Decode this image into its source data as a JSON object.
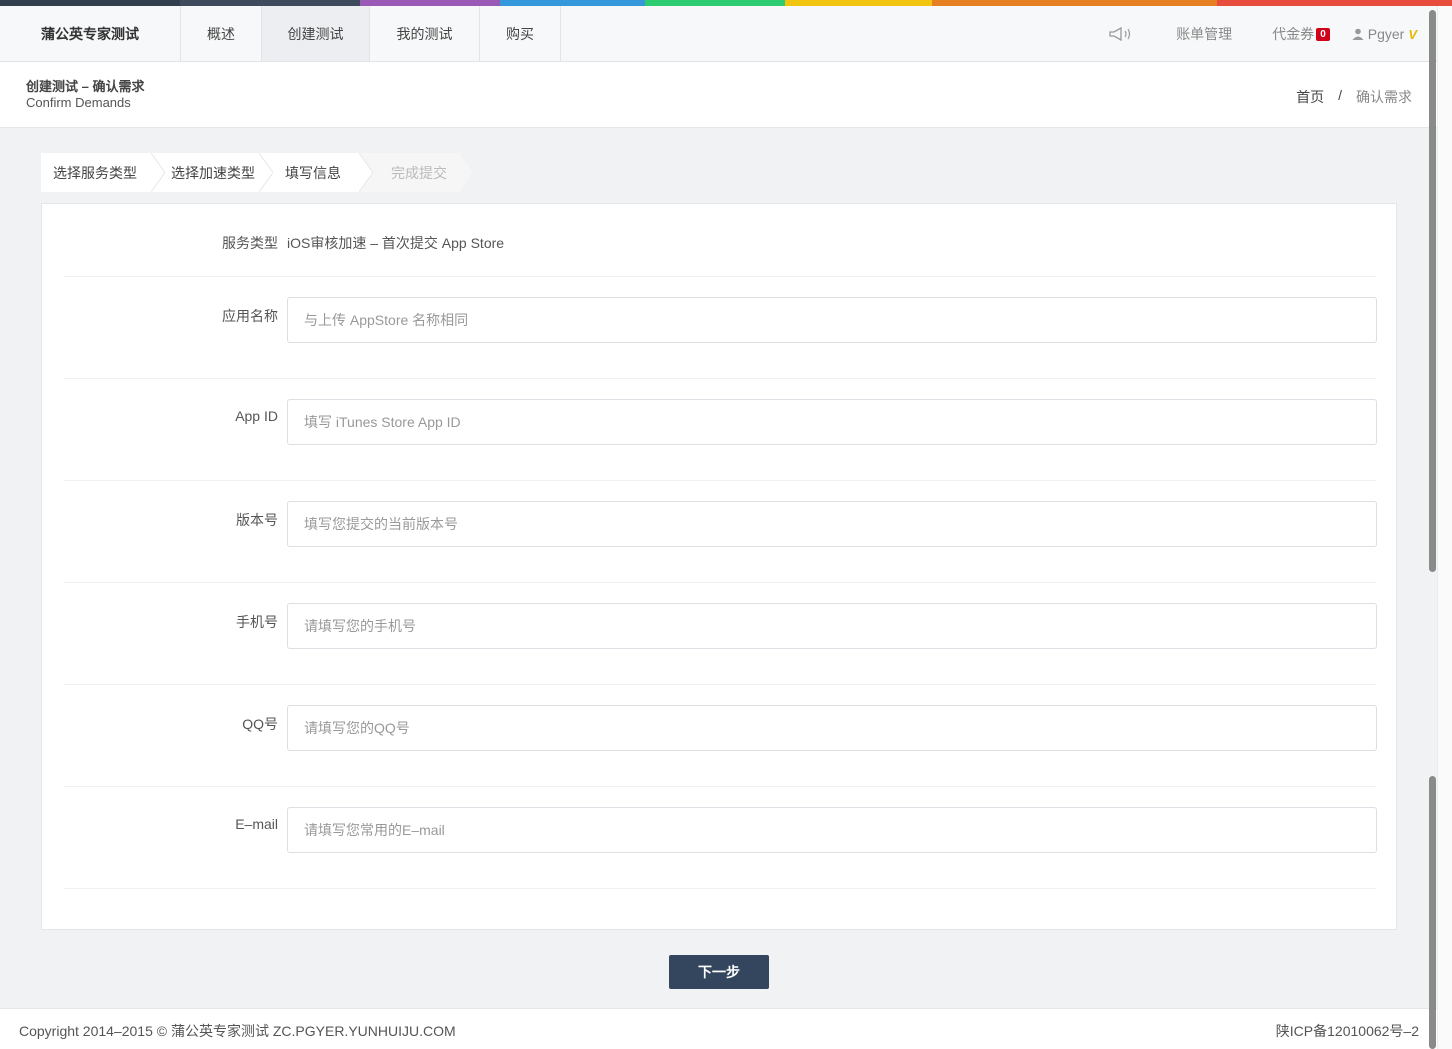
{
  "colors": {
    "rainbow": [
      "#333e4c",
      "#3e4b5c",
      "#9b59b6",
      "#3498db",
      "#2ecc71",
      "#f1c40f",
      "#e67e22",
      "#e74c3c"
    ],
    "primary": "#34465d",
    "badge": "#d0021b"
  },
  "nav": {
    "brand": "蒲公英专家测试",
    "items": [
      "概述",
      "创建测试",
      "我的测试",
      "购买"
    ],
    "active_index": 1,
    "billing": "账单管理",
    "voucher": "代金券",
    "voucher_count": "0",
    "user": "Pgyer",
    "user_mark": "V"
  },
  "page_header": {
    "title": "创建测试 – 确认需求",
    "subtitle": "Confirm Demands",
    "breadcrumb_home": "首页",
    "breadcrumb_sep": "/",
    "breadcrumb_current": "确认需求"
  },
  "steps": [
    "选择服务类型",
    "选择加速类型",
    "填写信息",
    "完成提交"
  ],
  "form": {
    "service_label": "服务类型",
    "service_value": "iOS审核加速 – 首次提交 App Store",
    "fields": [
      {
        "label": "应用名称",
        "placeholder": "与上传 AppStore 名称相同",
        "value": ""
      },
      {
        "label": "App ID",
        "placeholder": "填写 iTunes Store App ID",
        "value": ""
      },
      {
        "label": "版本号",
        "placeholder": "填写您提交的当前版本号",
        "value": ""
      },
      {
        "label": "手机号",
        "placeholder": "请填写您的手机号",
        "value": ""
      },
      {
        "label": "QQ号",
        "placeholder": "请填写您的QQ号",
        "value": ""
      },
      {
        "label": "E–mail",
        "placeholder": "请填写您常用的E–mail",
        "value": ""
      }
    ],
    "next_label": "下一步"
  },
  "footer": {
    "copyright": "Copyright 2014–2015 © 蒲公英专家测试 ZC.PGYER.YUNHUIJU.COM",
    "icp": "陕ICP备12010062号–2"
  }
}
